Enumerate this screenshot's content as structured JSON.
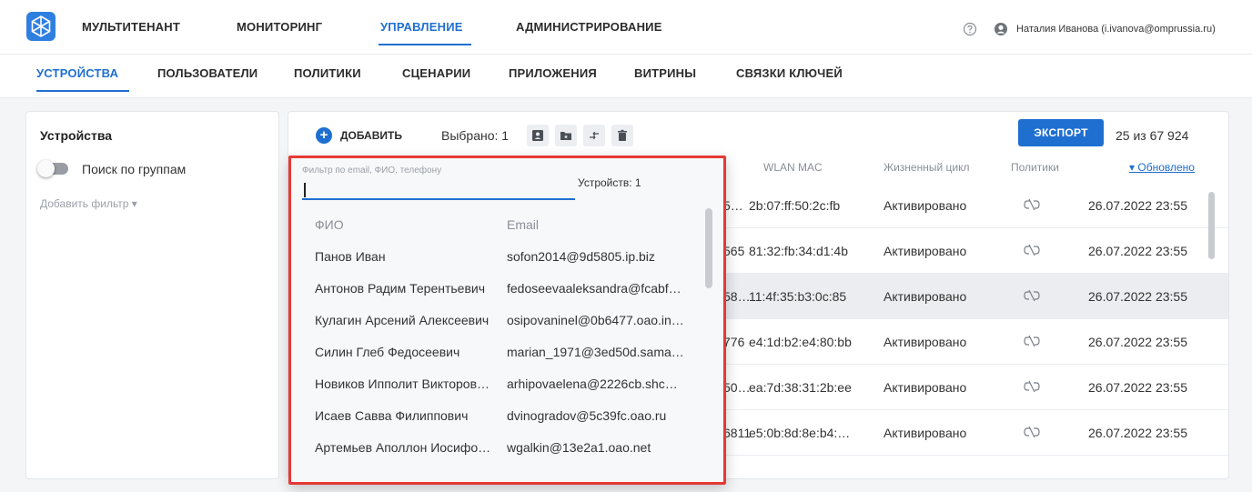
{
  "topnav": {
    "items": [
      "МУЛЬТИТЕНАНТ",
      "МОНИТОРИНГ",
      "УПРАВЛЕНИЕ",
      "АДМИНИСТРИРОВАНИЕ"
    ],
    "active": "УПРАВЛЕНИЕ"
  },
  "user": {
    "name": "Наталия Иванова (i.ivanova@omprussia.ru)"
  },
  "subnav": {
    "items": [
      "УСТРОЙСТВА",
      "ПОЛЬЗОВАТЕЛИ",
      "ПОЛИТИКИ",
      "СЦЕНАРИИ",
      "ПРИЛОЖЕНИЯ",
      "ВИТРИНЫ",
      "СВЯЗКИ КЛЮЧЕЙ"
    ],
    "active": "УСТРОЙСТВА"
  },
  "sidebar": {
    "title": "Устройства",
    "toggle_label": "Поиск по группам",
    "toggle_on": false,
    "add_filter": "Добавить фильтр ▾"
  },
  "toolbar": {
    "add_label": "ДОБАВИТЬ",
    "selected_label": "Выбрано: 1",
    "export_label": "ЭКСПОРТ",
    "count_label": "25 из 67 924"
  },
  "table": {
    "columns": {
      "wlan": "WLAN MAC",
      "lifecycle": "Жизненный цикл",
      "policies": "Политики",
      "updated": "▾ Обновлено"
    },
    "rows": [
      {
        "partial": "5…",
        "wlan": "2b:07:ff:50:2c:fb",
        "lifecycle": "Активировано",
        "updated": "26.07.2022 23:55"
      },
      {
        "partial": "565",
        "wlan": "81:32:fb:34:d1:4b",
        "lifecycle": "Активировано",
        "updated": "26.07.2022 23:55"
      },
      {
        "partial": "58…",
        "wlan": "11:4f:35:b3:0c:85",
        "lifecycle": "Активировано",
        "updated": "26.07.2022 23:55"
      },
      {
        "partial": "776",
        "wlan": "e4:1d:b2:e4:80:bb",
        "lifecycle": "Активировано",
        "updated": "26.07.2022 23:55"
      },
      {
        "partial": "50…",
        "wlan": "ea:7d:38:31:2b:ee",
        "lifecycle": "Активировано",
        "updated": "26.07.2022 23:55"
      },
      {
        "partial": "6811",
        "wlan": "e5:0b:8d:8e:b4:…",
        "lifecycle": "Активировано",
        "updated": "26.07.2022 23:55"
      }
    ]
  },
  "popup": {
    "filter_placeholder": "Фильтр по email, ФИО, телефону",
    "filter_value": "",
    "device_count": "Устройств: 1",
    "col_name": "ФИО",
    "col_email": "Email",
    "users": [
      {
        "name": "Панов Иван",
        "email": "sofon2014@9d5805.ip.biz"
      },
      {
        "name": "Антонов Радим Терентьевич",
        "email": "fedoseevaaleksandra@fcabf…"
      },
      {
        "name": "Кулагин Арсений Алексеевич",
        "email": "osipovaninel@0b6477.oao.in…"
      },
      {
        "name": "Силин Глеб Федосеевич",
        "email": "marian_1971@3ed50d.sama…"
      },
      {
        "name": "Новиков Ипполит Викторов…",
        "email": "arhipovaelena@2226cb.shc…"
      },
      {
        "name": "Исаев Савва Филиппович",
        "email": "dvinogradov@5c39fc.oao.ru"
      },
      {
        "name": "Артемьев Аполлон Иосифо…",
        "email": "wgalkin@13e2a1.oao.net"
      }
    ]
  },
  "colors": {
    "accent": "#1f6fd1",
    "highlight_frame": "#e53935"
  }
}
